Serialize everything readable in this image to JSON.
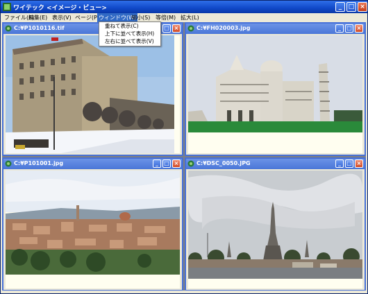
{
  "app": {
    "title": "ワイテック <イメージ・ビュー>"
  },
  "window_controls": {
    "minimize": "_",
    "maximize": "□",
    "close": "×"
  },
  "menu": [
    {
      "label": "ファイル(F)"
    },
    {
      "label": "編集(E)"
    },
    {
      "label": "表示(V)"
    },
    {
      "label": "ページ(P)"
    },
    {
      "label": "ウィンドウ(W)",
      "active": true
    },
    {
      "label": "縮小(S)"
    },
    {
      "label": "等倍(M)"
    },
    {
      "label": "拡大(L)"
    }
  ],
  "window_menu": [
    {
      "label": "重ねて表示(C)"
    },
    {
      "label": "上下に並べて表示(H)"
    },
    {
      "label": "左右に並べて表示(V)"
    }
  ],
  "children": [
    {
      "title": "C:¥P1010116.tif",
      "icon": "image-document-icon",
      "subject": "snowy street with hotel"
    },
    {
      "title": "C:¥FH020003.jpg",
      "icon": "image-document-icon",
      "subject": "pisa cathedral and leaning tower"
    },
    {
      "title": "C:¥P101001.jpg",
      "icon": "image-document-icon",
      "subject": "florence city panorama"
    },
    {
      "title": "C:¥DSC_0050.JPG",
      "icon": "image-document-icon",
      "subject": "wat arun temple by river"
    }
  ],
  "colors": {
    "titlebar": "#1048c8",
    "child_titlebar": "#4a76d8",
    "menu_highlight": "#316ac5"
  }
}
